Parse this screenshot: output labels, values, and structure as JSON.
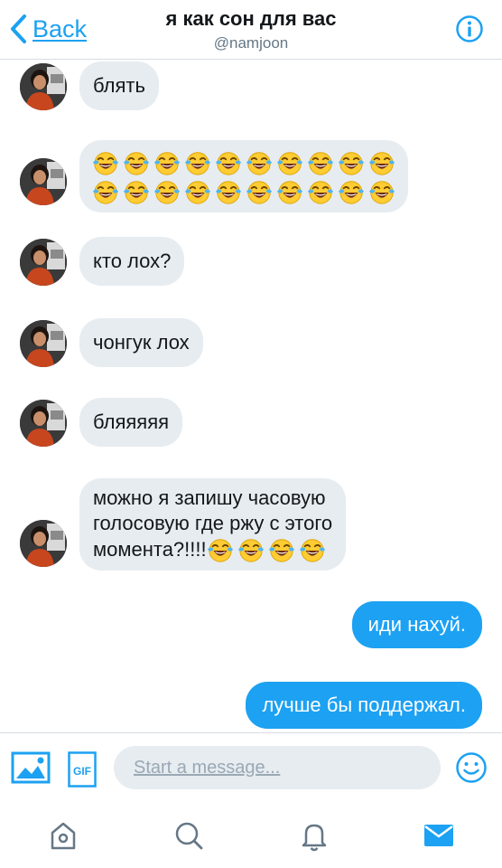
{
  "header": {
    "back_label": "Back",
    "title": "я как сон для вас",
    "handle": "@namjoon"
  },
  "colors": {
    "accent": "#1da1f2",
    "incoming_bubble": "#e6ecf0",
    "outgoing_bubble": "#1da1f2",
    "divider": "#d8dde2"
  },
  "messages": [
    {
      "direction": "in",
      "text": "блять"
    },
    {
      "direction": "in",
      "emoji": "face-with-tears-of-joy",
      "emoji_count": 20
    },
    {
      "direction": "in",
      "text": "кто лох?"
    },
    {
      "direction": "in",
      "text": "чонгук лох"
    },
    {
      "direction": "in",
      "text": "бляяяяя"
    },
    {
      "direction": "in",
      "line1": "можно я запишу часовую",
      "line2": "голосовую где ржу с этого",
      "line3": "момента?!!!!",
      "emoji": "face-with-tears-of-joy",
      "emoji_count": 4
    },
    {
      "direction": "out",
      "text": "иди нахуй."
    },
    {
      "direction": "out",
      "text": "лучше бы поддержал."
    }
  ],
  "composer": {
    "placeholder": "Start a message...",
    "image_icon": "image-icon",
    "gif_label": "GIF",
    "emoji_icon": "smiley-icon"
  },
  "tabbar": {
    "items": [
      "home-icon",
      "search-icon",
      "bell-icon",
      "mail-icon"
    ],
    "active": "mail-icon"
  }
}
